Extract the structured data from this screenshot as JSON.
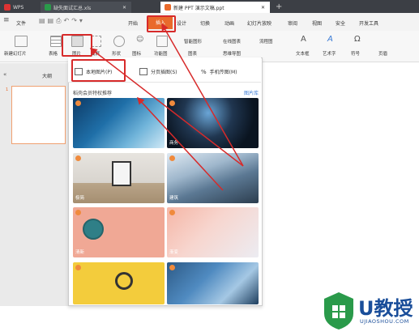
{
  "titlebar": {
    "tabs": [
      {
        "label": "WPS"
      },
      {
        "label": "缺失面试汇总.xls"
      },
      {
        "label": "新建 PPT 演示文稿.ppt"
      }
    ],
    "new_tab": "+"
  },
  "menubar": {
    "items": [
      "文件",
      "开始",
      "插入",
      "设计",
      "切换",
      "动画",
      "幻灯片放映",
      "审阅",
      "视图",
      "安全",
      "开发工具"
    ]
  },
  "ribbon": {
    "items": [
      "新建幻灯片",
      "表格",
      "图片",
      "截屏",
      "形状",
      "图标",
      "功能图",
      "智能图形",
      "在线图表",
      "图表",
      "流程图",
      "思维导图",
      "文本框",
      "艺术字",
      "符号",
      "页眉"
    ]
  },
  "left_panel": {
    "tab_label": "大纲",
    "slide_number": "1"
  },
  "picture_panel": {
    "options": [
      "本地图片(P)",
      "分页插图(S)",
      "手机传图(M)"
    ],
    "section_title": "稻壳会员特权推荐",
    "library_link": "图片库",
    "thumb_labels": [
      "商务",
      "极简",
      "建筑",
      "清新",
      "渐变"
    ]
  },
  "logo": {
    "main": "U教授",
    "sub": "UJIAOSHOU.COM"
  },
  "colors": {
    "accent": "#e96a2b",
    "annotation": "#d72a2a",
    "logo_green": "#2a9a4a",
    "logo_blue": "#1a4e9a"
  }
}
